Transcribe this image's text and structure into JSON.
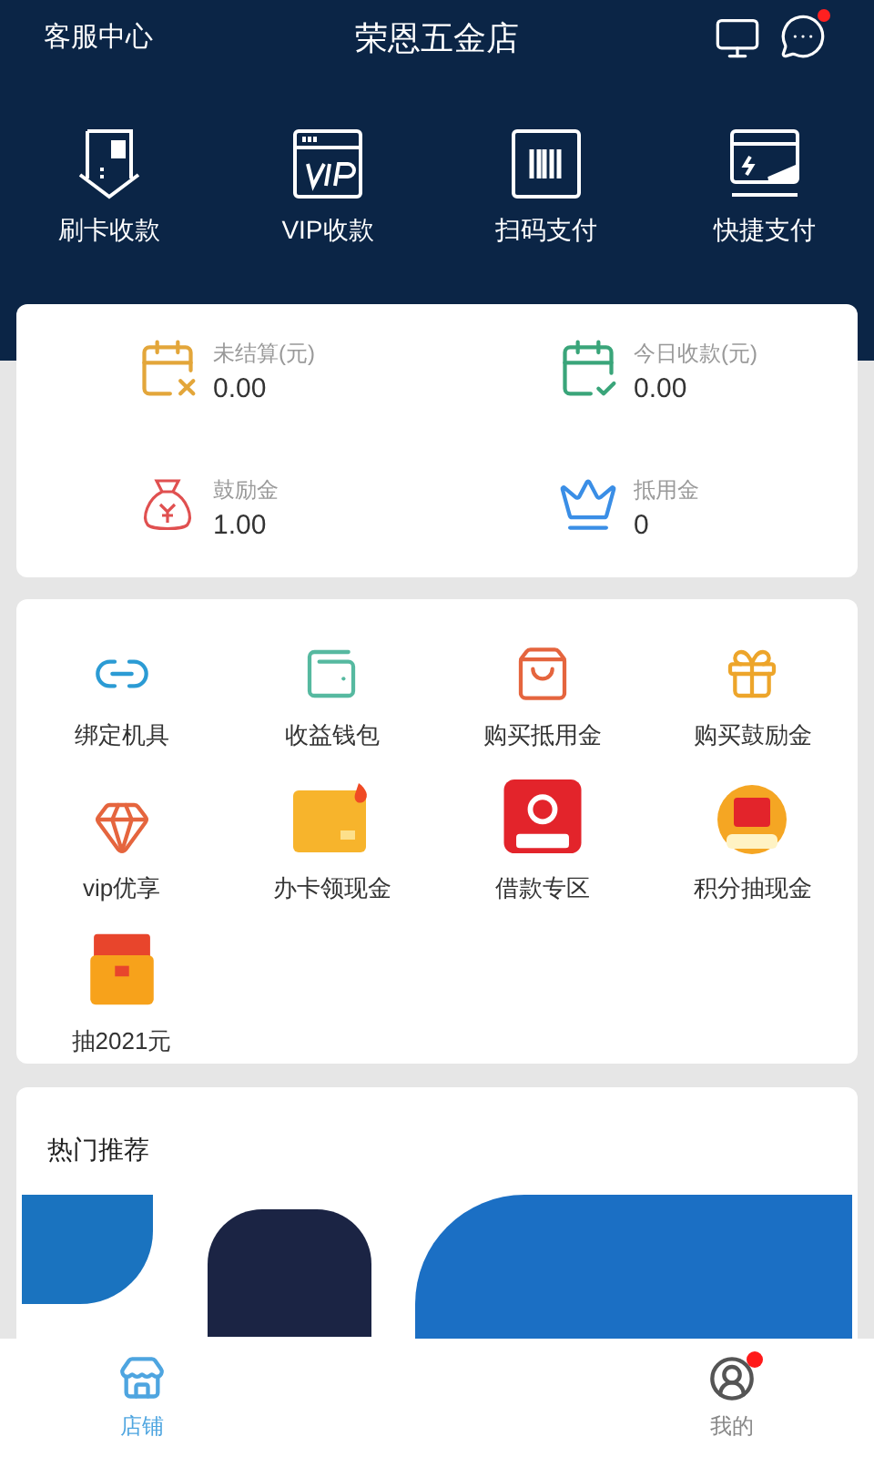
{
  "header": {
    "left_link": "客服中心",
    "title": "荣恩五金店",
    "message_dot": true
  },
  "quick_actions": [
    {
      "kind": "card",
      "label": "刷卡收款"
    },
    {
      "kind": "vip",
      "label": "VIP收款"
    },
    {
      "kind": "barcode",
      "label": "扫码支付"
    },
    {
      "kind": "flash",
      "label": "快捷支付"
    }
  ],
  "stats": [
    {
      "kind": "pending",
      "label": "未结算(元)",
      "value": "0.00",
      "color": "#e3a63a"
    },
    {
      "kind": "today",
      "label": "今日收款(元)",
      "value": "0.00",
      "color": "#3aa57a"
    },
    {
      "kind": "bonus",
      "label": "鼓励金",
      "value": "1.00",
      "color": "#e05050"
    },
    {
      "kind": "voucher",
      "label": "抵用金",
      "value": "0",
      "color": "#3a8ee6"
    }
  ],
  "services": [
    {
      "kind": "link",
      "label": "绑定机具"
    },
    {
      "kind": "wallet",
      "label": "收益钱包"
    },
    {
      "kind": "bag",
      "label": "购买抵用金"
    },
    {
      "kind": "gift",
      "label": "购买鼓励金"
    },
    {
      "kind": "gem",
      "label": "vip优享"
    },
    {
      "kind": "yellowcard",
      "label": "办卡领现金"
    },
    {
      "kind": "loan",
      "label": "借款专区"
    },
    {
      "kind": "coin",
      "label": "积分抽现金"
    },
    {
      "kind": "box",
      "label": "抽2021元"
    }
  ],
  "hot": {
    "title": "热门推荐"
  },
  "tabs": [
    {
      "kind": "shop",
      "label": "店铺",
      "selected": true,
      "dot": false
    },
    {
      "kind": "me",
      "label": "我的",
      "selected": false,
      "dot": true
    }
  ]
}
